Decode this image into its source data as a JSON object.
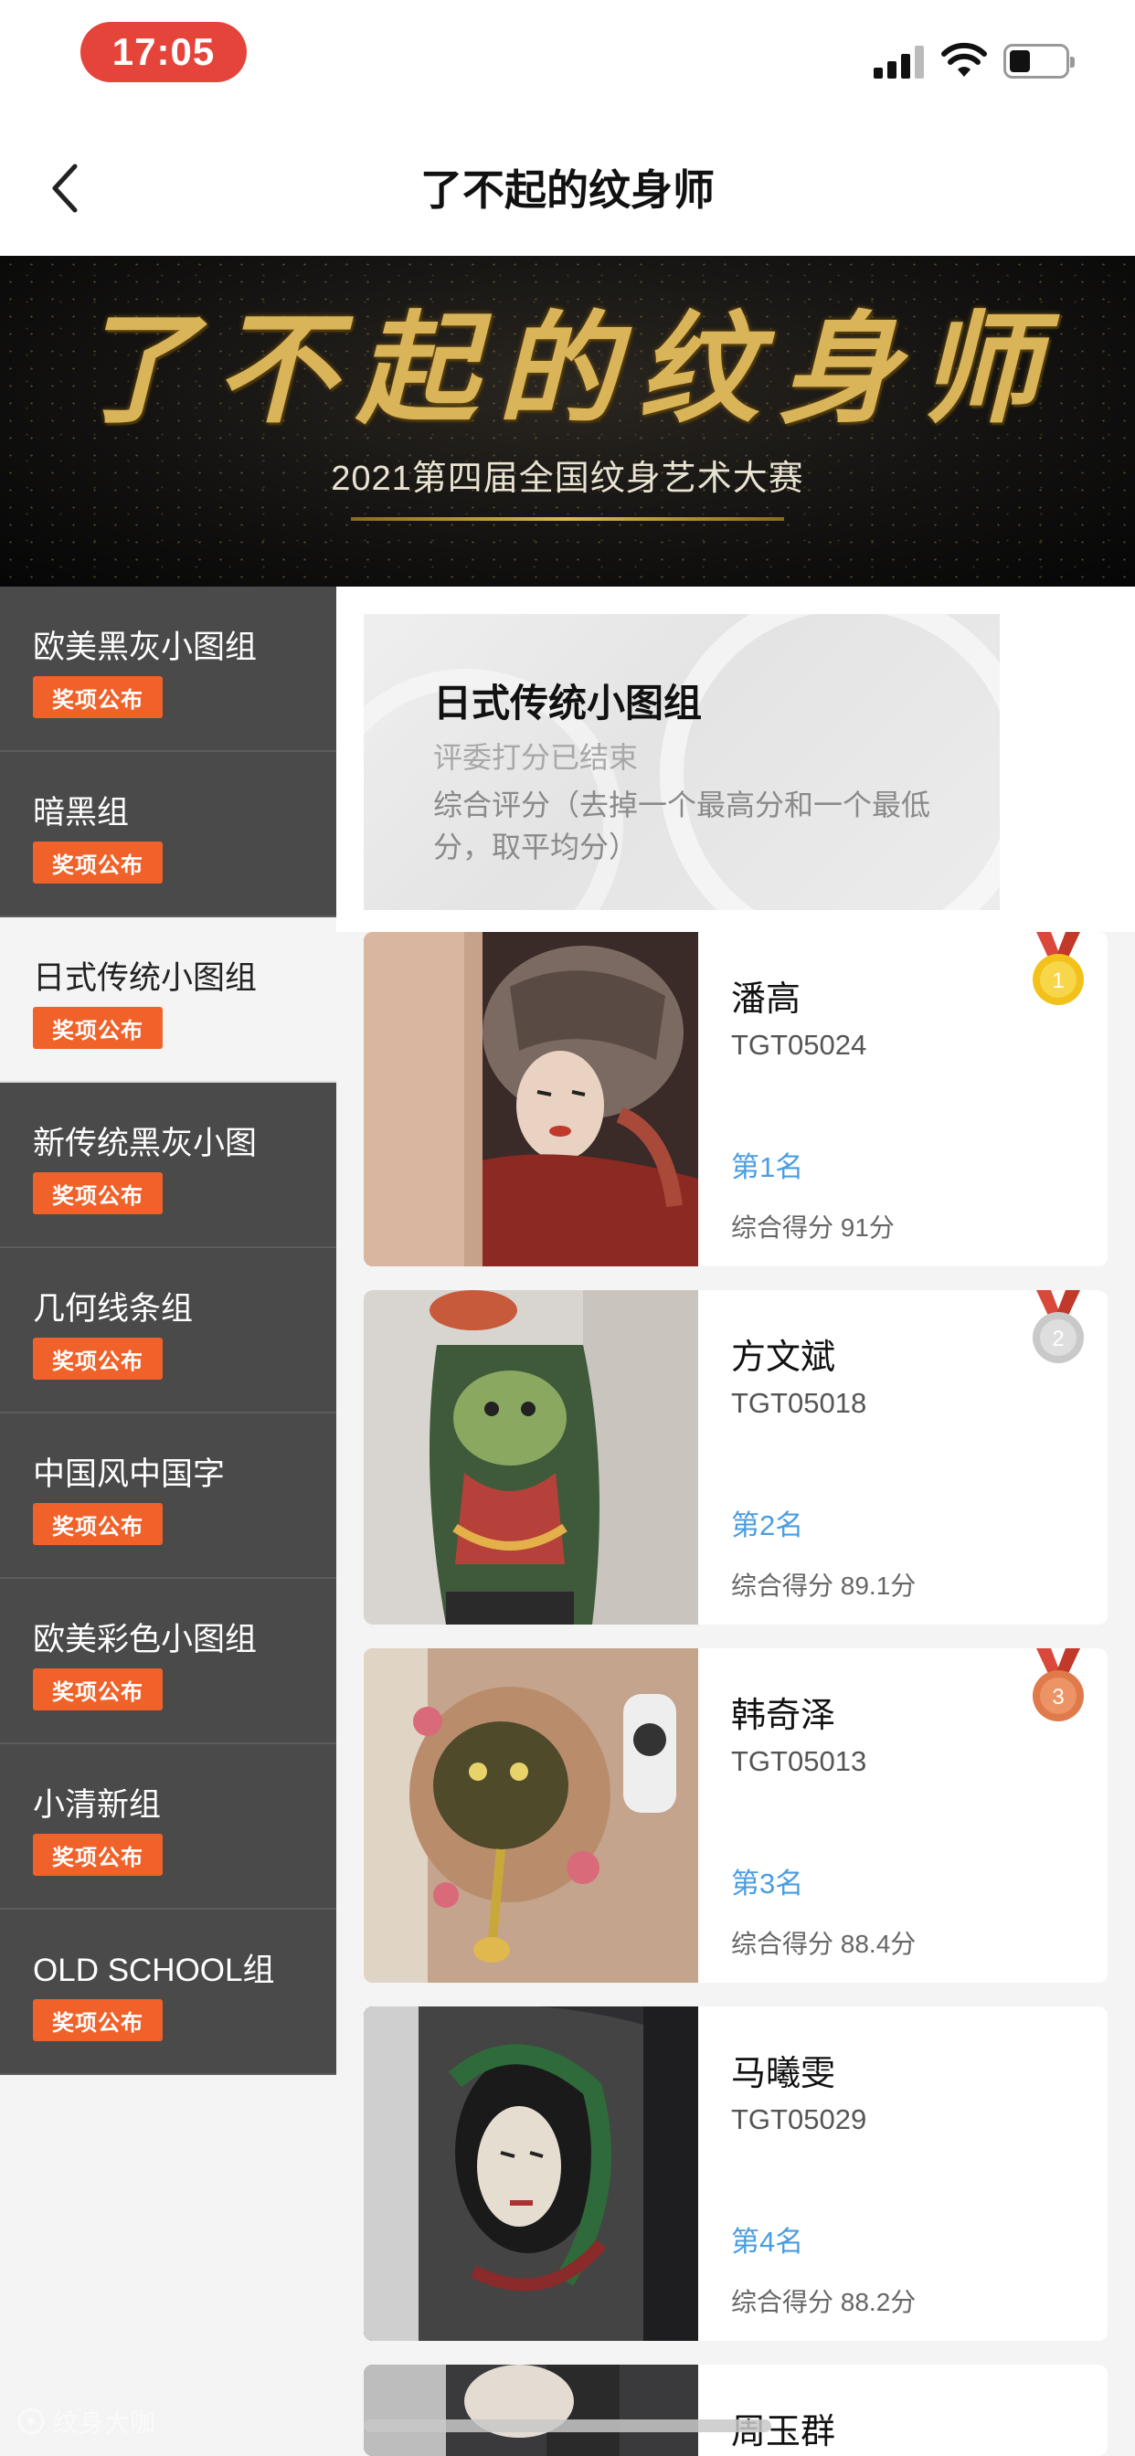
{
  "status_bar": {
    "time": "17:05"
  },
  "nav": {
    "title": "了不起的纹身师"
  },
  "banner": {
    "title": "了不起的纹身师",
    "subtitle": "2021第四届全国纹身艺术大赛"
  },
  "sidebar": {
    "badge_label": "奖项公布",
    "items": [
      {
        "label": "欧美黑灰小图组"
      },
      {
        "label": "暗黑组"
      },
      {
        "label": "日式传统小图组",
        "active": true
      },
      {
        "label": "新传统黑灰小图"
      },
      {
        "label": "几何线条组"
      },
      {
        "label": "中国风中国字"
      },
      {
        "label": "欧美彩色小图组"
      },
      {
        "label": "小清新组"
      },
      {
        "label": "OLD SCHOOL组"
      }
    ]
  },
  "group": {
    "title": "日式传统小图组",
    "status": "评委打分已结束",
    "rule": "综合评分（去掉一个最高分和一个最低分，取平均分）"
  },
  "entries": [
    {
      "name": "潘高",
      "code": "TGT05024",
      "rank": "第1名",
      "score": "综合得分 91分",
      "medal": "1",
      "medal_color": "#f2c21b"
    },
    {
      "name": "方文斌",
      "code": "TGT05018",
      "rank": "第2名",
      "score": "综合得分 89.1分",
      "medal": "2",
      "medal_color": "#c9c9c9"
    },
    {
      "name": "韩奇泽",
      "code": "TGT05013",
      "rank": "第3名",
      "score": "综合得分 88.4分",
      "medal": "3",
      "medal_color": "#e07a4a"
    },
    {
      "name": "马曦雯",
      "code": "TGT05029",
      "rank": "第4名",
      "score": "综合得分 88.2分"
    },
    {
      "name": "周玉群"
    }
  ],
  "watermark": "纹身大咖",
  "colors": {
    "accent": "#f0622a",
    "rank_blue": "#4a9de0",
    "sidebar_dark": "#4a4a4a",
    "status_red": "#e5443b"
  }
}
